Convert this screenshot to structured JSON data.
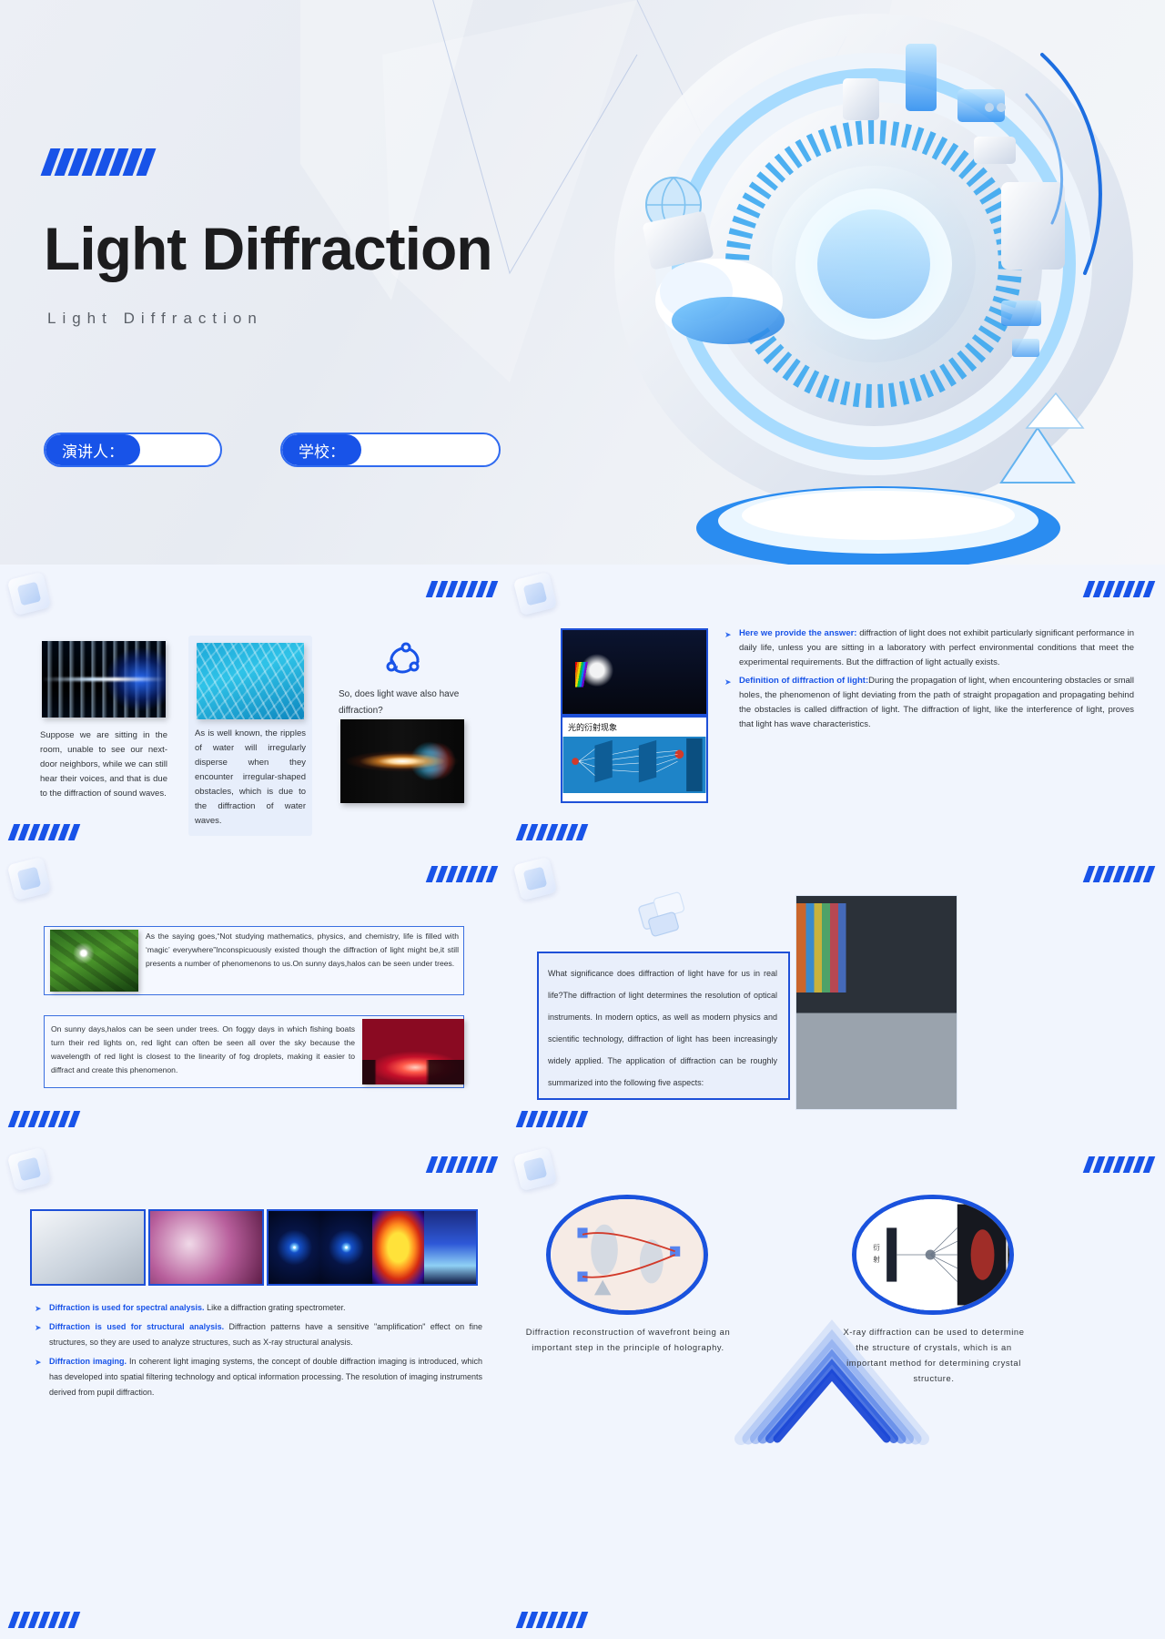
{
  "cover": {
    "title": "Light Diffraction",
    "subtitle": "Light  Diffraction",
    "speaker_label": "演讲人：",
    "speaker_value": "",
    "school_label": "学校：",
    "school_value": "",
    "accent_color": "#1853e8",
    "hatch_icon": "hatch-stripes-icon"
  },
  "slide2": {
    "left": {
      "card1_caption": "Suppose we are sitting in the room, unable to see our next-door neighbors, while we can still hear their voices, and that is due to the diffraction of sound waves.",
      "card1_image": "sound-wave-ear-image",
      "card2_caption": "As is well known, the ripples of water will irregularly disperse when they encounter irregular-shaped obstacles, which is due to the diffraction of water waves.",
      "card2_image": "water-ripples-image",
      "question": "So, does light wave also have diffraction?",
      "question_icon": "recycle-arrows-icon",
      "card3_image": "diffraction-fringe-image"
    },
    "right": {
      "image_prism": "prism-spectrum-image",
      "image_diagram": "diffraction-diagram-image",
      "diagram_label": "光的衍射现象",
      "bullets": [
        {
          "head": "Here we provide the answer:",
          "body": " diffraction of light does not exhibit particularly significant performance in daily life, unless you are sitting in a laboratory with perfect environmental conditions that meet the experimental requirements. But the diffraction of light actually exists."
        },
        {
          "head": "Definition of diffraction of light:",
          "body": "During the propagation of light, when encountering obstacles or small holes, the phenomenon of light deviating from the path of straight propagation and propagating behind the obstacles is called diffraction of light. The diffraction of light, like the interference of light, proves that light has wave characteristics."
        }
      ]
    }
  },
  "slide3": {
    "image_forest": "sunlight-through-trees-image",
    "text_top": "As the saying goes,“Not studying mathematics, physics, and chemistry, life is filled with ‘magic’ everywhere”Inconspicuously existed though the diffraction of light might be,it still presents a number of phenomenons to us.On sunny days,halos can be seen under trees.",
    "text_bottom": "On sunny days,halos can be seen under trees. On foggy days in which fishing boats turn their red lights on, red light can often be seen all over the sky because the wavelength of red light is closest to the linearity of fog droplets, making it easier to diffract and create this phenomenon.",
    "image_redsky": "red-sky-fog-image"
  },
  "slide4": {
    "text": "What significance does diffraction of light have for us in real life?The diffraction of light determines the resolution of optical instruments. In modern optics, as well as modern physics and scientific technology, diffraction of light has been increasingly widely applied. The application of diffraction can be roughly summarized into the following five aspects:",
    "image_office": "office-meeting-image",
    "decor_icon": "glass-cube-icon"
  },
  "slide5": {
    "images": [
      "spectrometer-instrument-image",
      "grating-microscopy-image",
      "fft-pattern-image",
      "intensity-map-image",
      "heatmap-image",
      "3d-surface-plot-image"
    ],
    "bullets": [
      {
        "head": "Diffraction is used for spectral analysis.",
        "body": " Like a diffraction grating spectrometer."
      },
      {
        "head": "Diffraction is used for structural analysis.",
        "body": " Diffraction patterns have a sensitive \"amplification\" effect on fine structures, so they are used to analyze structures, such as X-ray structural analysis."
      },
      {
        "head": "Diffraction imaging.",
        "body": " In coherent light imaging systems, the concept of double diffraction imaging is introduced, which has developed into spatial filtering technology and optical information processing. The resolution of imaging instruments derived from pupil diffraction."
      }
    ]
  },
  "slide6": {
    "left_image": "holography-setup-image",
    "left_caption": "Diffraction reconstruction of wavefront being an important step in the principle of holography.",
    "right_image": "xray-crystal-diffraction-image",
    "right_caption": "X-ray diffraction can be used to determine the structure of crystals, which is an important method for determining crystal structure.",
    "center_icon": "double-chevron-up-icon"
  }
}
